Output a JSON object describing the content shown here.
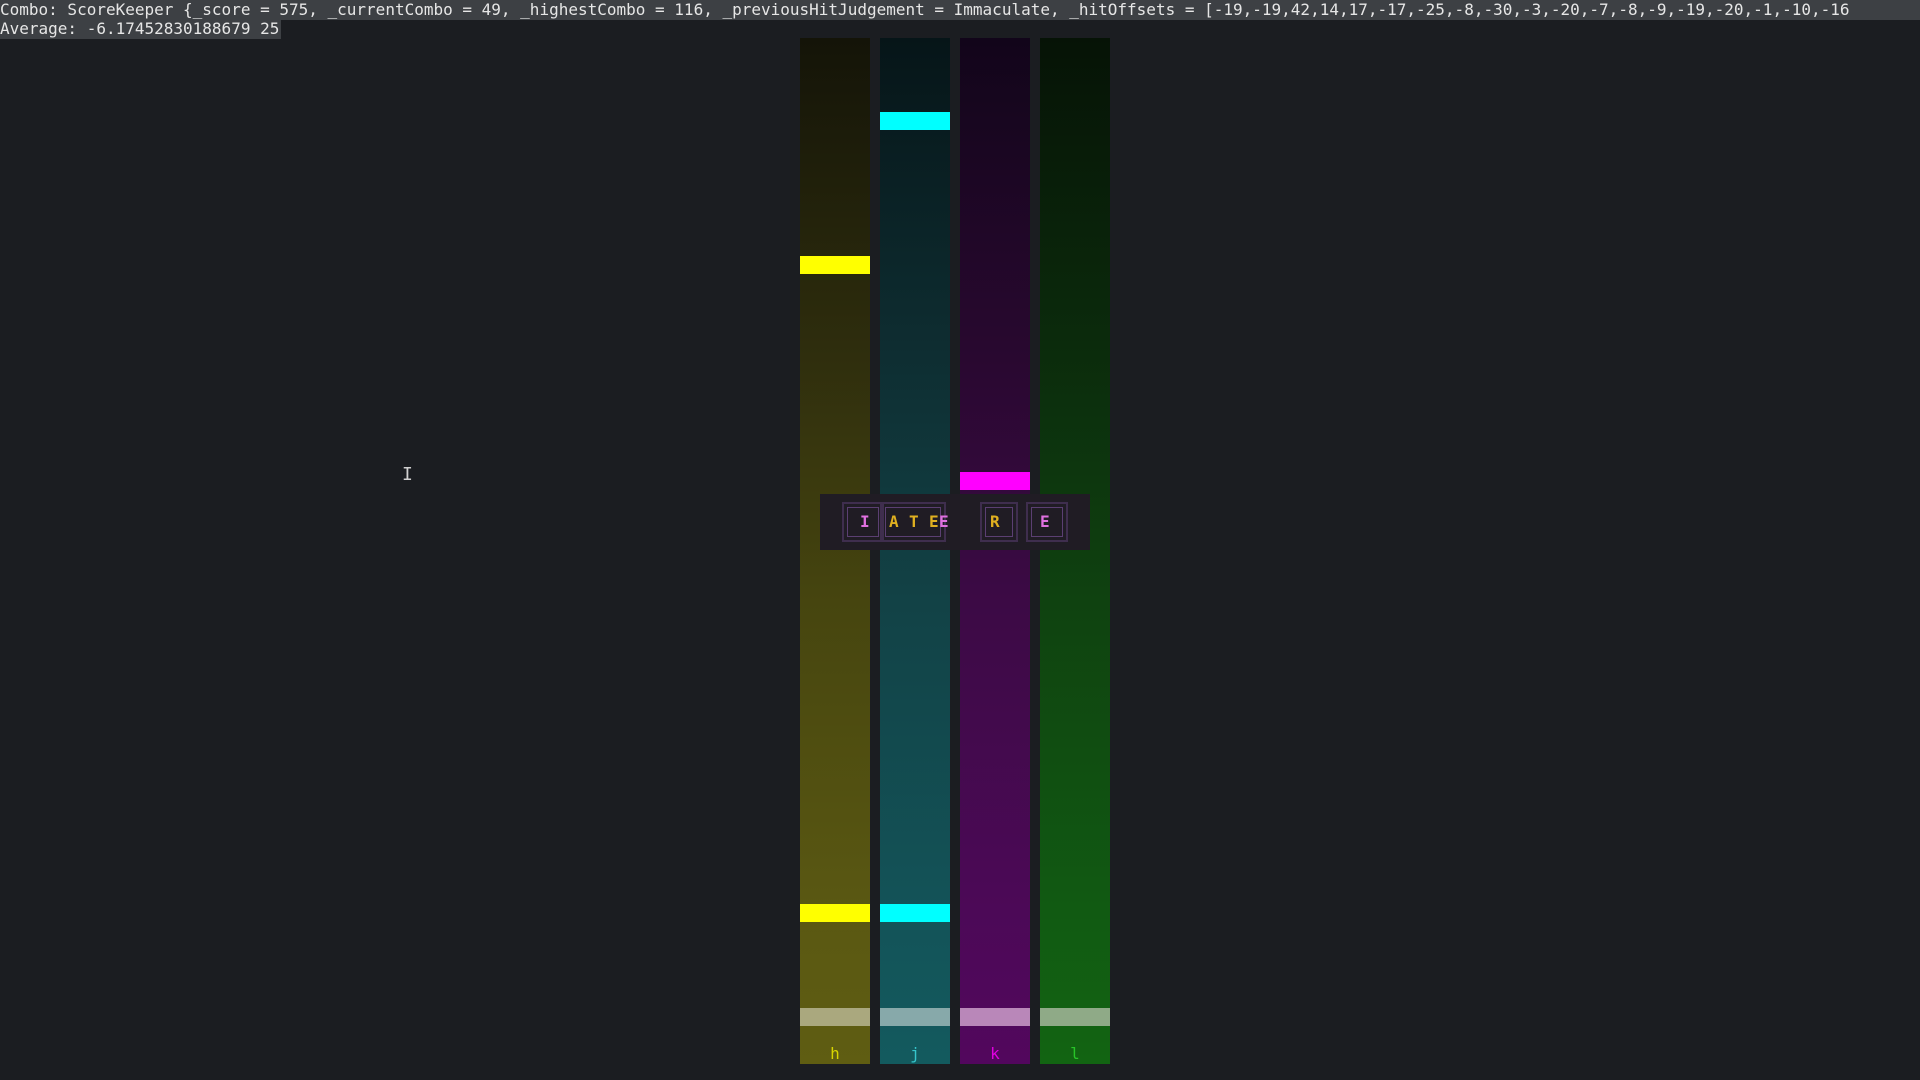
{
  "debug": {
    "combo_line": "Combo: ScoreKeeper {_score = 575, _currentCombo = 49, _highestCombo = 116, _previousHitJudgement = Immaculate, _hitOffsets = [-19,-19,42,14,17,-17,-25,-8,-30,-3,-20,-7,-8,-9,-19,-20,-1,-10,-16",
    "average_line": "Average: -6.17452830188679 25"
  },
  "lanes": [
    {
      "key": "h",
      "color": "#ffff00"
    },
    {
      "key": "j",
      "color": "#00ffff"
    },
    {
      "key": "k",
      "color": "#ff00ff"
    },
    {
      "key": "l",
      "color": "#00ff00"
    }
  ],
  "hit_line_colors": [
    "#aaa87e",
    "#87a9aa",
    "#b987b9",
    "#8faa87"
  ],
  "key_label_colors": [
    "#d8d400",
    "#36c6cc",
    "#e000e0",
    "#28c428"
  ],
  "judgement": {
    "letters": [
      "I",
      "A",
      "T",
      "E",
      "E",
      "R",
      "E"
    ],
    "letter_colors": [
      "#e070e0",
      "#e0b020",
      "#e0b020",
      "#e0b020",
      "#e070e0",
      "#e0b020",
      "#e070e0"
    ]
  },
  "cursor_glyph": "I"
}
